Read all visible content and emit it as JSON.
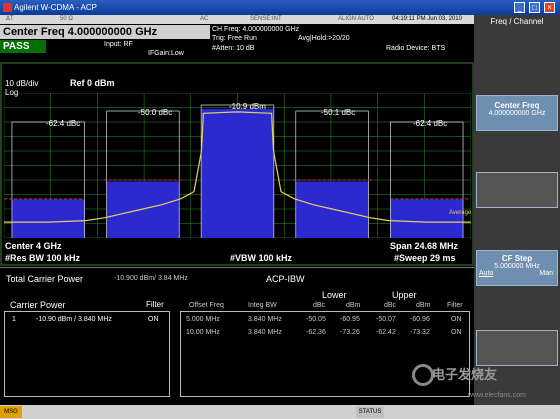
{
  "titlebar": {
    "title": "Agilent W-CDMA - ACP"
  },
  "topstrip": {
    "a": "ΔT",
    "b": "50 Ω",
    "c": "AC",
    "d": "SENSE:INT",
    "e": "ALIGN AUTO",
    "time": "04:19:11 PM Jun 03, 2010"
  },
  "header": {
    "center_freq": "Center Freq  4.000000000 GHz",
    "pass": "PASS",
    "input": "Input: RF",
    "ifgain": "IFGain:Low",
    "ch_freq": "CH Freq: 4.000000000 GHz",
    "trig": "Trig: Free Run",
    "avg": "Avg|Hold:>20/20",
    "atten": "#Atten: 10 dB",
    "radio": "Radio Device: BTS"
  },
  "softkeys": {
    "menu_title": "Freq / Channel",
    "center_freq_label": "Center Freq",
    "center_freq_value": "4.000000000 GHz",
    "cf_step_label": "CF Step",
    "cf_step_value": "5.000000 MHz",
    "auto": "Auto",
    "man": "Man"
  },
  "plot": {
    "scale": "10 dB/div",
    "log": "Log",
    "ref": "Ref  0 dBm",
    "center": "Center  4 GHz",
    "res_bw": "#Res BW  100 kHz",
    "vbw": "#VBW  100 kHz",
    "span": "Span 24.68 MHz",
    "sweep": "#Sweep  29 ms",
    "average": "Average",
    "labels": {
      "l2": "-62.4 dBc",
      "l1": "-50.0 dBc",
      "main": "-10.9 dBm",
      "r1": "-50.1 dBc",
      "r2": "-62.4 dBc"
    }
  },
  "chart_data": {
    "type": "line",
    "title": "",
    "xlabel": "",
    "ylabel": "",
    "x_center_ghz": 4,
    "x_span_mhz": 24.68,
    "y_ref_dbm": 0,
    "y_scale_db_per_div": 10,
    "grid": true,
    "series": [
      {
        "name": "",
        "x_mhz": [
          -12.34,
          -10,
          -8,
          -7,
          -6,
          -5,
          -4,
          -3,
          -2.3,
          -1.9,
          -1.8,
          0,
          1.8,
          1.9,
          2.3,
          3,
          4,
          5,
          6,
          7,
          8,
          10,
          12.34
        ],
        "y_dbm": [
          -89,
          -89,
          -88,
          -86,
          -83,
          -80,
          -77,
          -73,
          -68,
          -40,
          -14,
          -13,
          -14,
          -40,
          -68,
          -73,
          -77,
          -80,
          -83,
          -86,
          -88,
          -89,
          -89
        ]
      }
    ],
    "bands": [
      {
        "label": "-62.4 dBc",
        "offset_mhz": -10,
        "level_dbm": -73.3
      },
      {
        "label": "-50.0 dBc",
        "offset_mhz": -5,
        "level_dbm": -61
      },
      {
        "label": "-10.9 dBm",
        "offset_mhz": 0,
        "level_dbm": -10.9
      },
      {
        "label": "-50.1 dBc",
        "offset_mhz": 5,
        "level_dbm": -61
      },
      {
        "label": "-62.4 dBc",
        "offset_mhz": 10,
        "level_dbm": -73.3
      }
    ]
  },
  "lower": {
    "total_carrier_power_label": "Total Carrier Power",
    "total_carrier_power_value": "-10.900 dBm/ 3.84 MHz",
    "acp_title": "ACP-IBW",
    "carrier_power_label": "Carrier Power",
    "filter_label": "Filter",
    "carrier_row": {
      "idx": "1",
      "value": "-10.90 dBm / 3.840 MHz",
      "filter": "ON"
    },
    "lower_label": "Lower",
    "upper_label": "Upper",
    "headers": {
      "offset": "Offset Freq",
      "integ": "Integ BW",
      "dbc1": "dBc",
      "dbm1": "dBm",
      "dbc2": "dBc",
      "dbm2": "dBm",
      "filter": "Filter"
    },
    "rows": [
      {
        "offset": "5.000 MHz",
        "integ": "3.840 MHz",
        "ldbc": "-50.05",
        "ldbm": "-60.95",
        "udbc": "-50.07",
        "udbm": "-60.96",
        "filter": "ON"
      },
      {
        "offset": "10.00 MHz",
        "integ": "3.840 MHz",
        "ldbc": "-62.36",
        "ldbm": "-73.26",
        "udbc": "-62.42",
        "udbm": "-73.32",
        "filter": "ON"
      }
    ]
  },
  "bottom": {
    "msg": "MSG",
    "status": "STATUS"
  },
  "watermark": {
    "text": "电子发烧友",
    "sub": "www.elecfans.com"
  },
  "colors": {
    "trace": "#e8d060",
    "band": "#2a2ad0",
    "limit": "#d03030",
    "grid": "#2f8f2f"
  }
}
